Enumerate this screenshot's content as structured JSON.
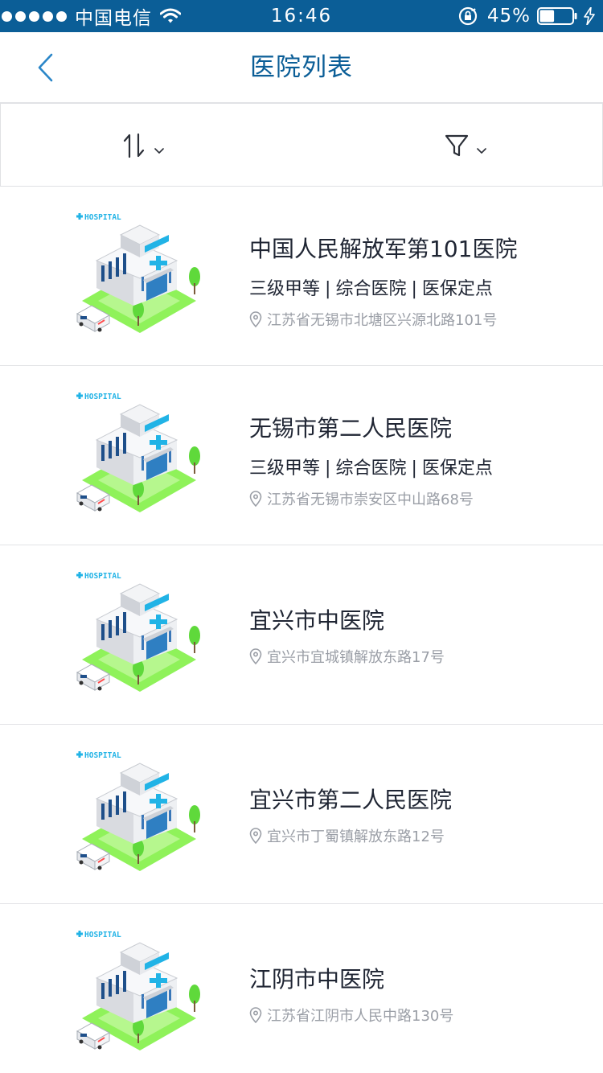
{
  "status_bar": {
    "carrier": "中国电信",
    "time": "16:46",
    "battery_percent": "45%",
    "battery_level": 0.45
  },
  "nav": {
    "title": "医院列表"
  },
  "filter_bar": {
    "sort_icon": "sort-arrows-icon",
    "filter_icon": "funnel-icon"
  },
  "hospitals": [
    {
      "name": "中国人民解放军第101医院",
      "tags": [
        "三级甲等",
        "综合医院",
        "医保定点"
      ],
      "address": "江苏省无锡市北塘区兴源北路101号",
      "logo_text": "HOSPITAL"
    },
    {
      "name": "无锡市第二人民医院",
      "tags": [
        "三级甲等",
        "综合医院",
        "医保定点"
      ],
      "address": "江苏省无锡市崇安区中山路68号",
      "logo_text": "HOSPITAL"
    },
    {
      "name": "宜兴市中医院",
      "tags": [],
      "address": "宜兴市宜城镇解放东路17号",
      "logo_text": "HOSPITAL"
    },
    {
      "name": "宜兴市第二人民医院",
      "tags": [],
      "address": "宜兴市丁蜀镇解放东路12号",
      "logo_text": "HOSPITAL"
    },
    {
      "name": "江阴市中医院",
      "tags": [],
      "address": "江苏省江阴市人民中路130号",
      "logo_text": "HOSPITAL"
    }
  ],
  "colors": {
    "brand": "#0b5e97",
    "text": "#1f2533",
    "muted": "#9a9ea6"
  }
}
